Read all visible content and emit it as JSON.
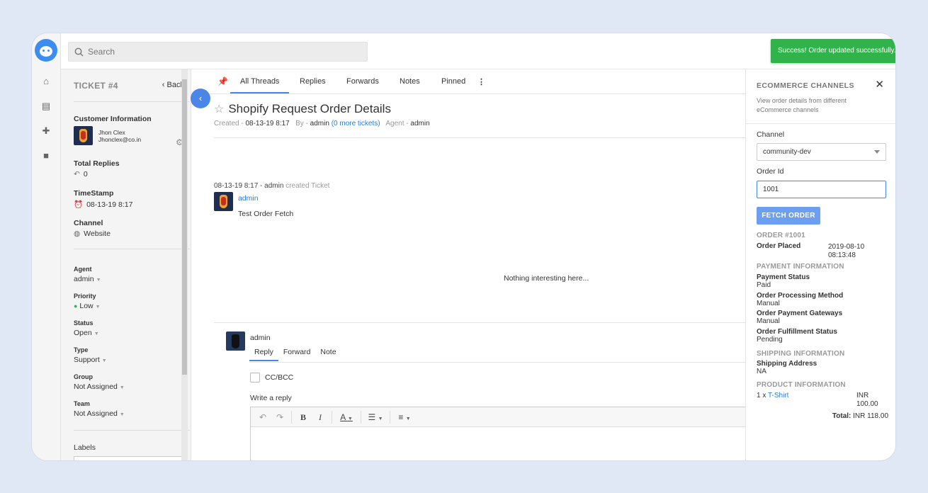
{
  "search": {
    "placeholder": "Search"
  },
  "toast": {
    "message": "Success! Order updated successfully.",
    "close": "×"
  },
  "ticket": {
    "number": "TICKET #4",
    "back": "Back",
    "customer_heading": "Customer Information",
    "customer_name": "Jhon Clex",
    "customer_email": "Jhonclex@co.in",
    "total_replies_label": "Total Replies",
    "total_replies": "0",
    "timestamp_label": "TimeStamp",
    "timestamp": "08-13-19 8:17",
    "channel_label": "Channel",
    "channel": "Website",
    "agent_label": "Agent",
    "agent": "admin",
    "priority_label": "Priority",
    "priority": "Low",
    "status_label": "Status",
    "status": "Open",
    "type_label": "Type",
    "type": "Support",
    "group_label": "Group",
    "group": "Not Assigned",
    "team_label": "Team",
    "team": "Not Assigned",
    "labels_label": "Labels"
  },
  "tabs": [
    "All Threads",
    "Replies",
    "Forwards",
    "Notes",
    "Pinned"
  ],
  "thread": {
    "title": "Shopify Request Order Details",
    "created_label": "Created -",
    "created": "08-13-19 8:17",
    "by_label": "By -",
    "by": "admin",
    "more_tickets": "(0 more tickets)",
    "agent_label": "Agent -",
    "agent": "admin",
    "entry_time": "08-13-19 8:17 - admin",
    "entry_action": "created Ticket",
    "author": "admin",
    "body": "Test Order Fetch",
    "empty": "Nothing interesting here..."
  },
  "reply": {
    "user": "admin",
    "tabs": [
      "Reply",
      "Forward",
      "Note"
    ],
    "cc_label": "CC/BCC",
    "write_label": "Write a reply"
  },
  "ecommerce": {
    "title": "ECOMMERCE CHANNELS",
    "description": "View order details from different eCommerce channels",
    "channel_label": "Channel",
    "channel_value": "community-dev",
    "order_id_label": "Order Id",
    "order_id_value": "1001",
    "fetch_button": "FETCH ORDER",
    "order_heading": "ORDER #1001",
    "order_placed_label": "Order Placed",
    "order_placed_date": "2019-08-10",
    "order_placed_time": "08:13:48",
    "payment_heading": "PAYMENT INFORMATION",
    "payment_status_label": "Payment Status",
    "payment_status": "Paid",
    "processing_label": "Order Processing Method",
    "processing": "Manual",
    "gateways_label": "Order Payment Gateways",
    "gateways": "Manual",
    "fulfillment_label": "Order Fulfillment Status",
    "fulfillment": "Pending",
    "shipping_heading": "SHIPPING INFORMATION",
    "shipping_label": "Shipping Address",
    "shipping": "NA",
    "product_heading": "PRODUCT INFORMATION",
    "product_qty": "1 x",
    "product_name": "T-Shirt",
    "product_currency": "INR",
    "product_price": "100.00",
    "total_label": "Total:",
    "total_value": "INR 118.00"
  },
  "colors": {
    "accent": "#4a86e8",
    "toast": "#2fb34a",
    "priority_low": "#2fb34a"
  }
}
